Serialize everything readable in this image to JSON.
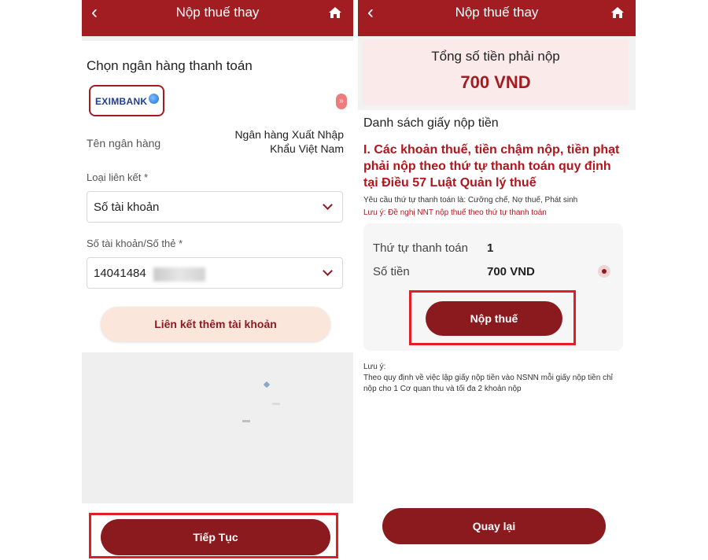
{
  "left": {
    "header": {
      "title": "Nộp thuế thay"
    },
    "section_title": "Chọn ngân hàng thanh toán",
    "bank": {
      "logo_text": "EXIMBANK",
      "name_label": "Tên ngân hàng",
      "name_value": "Ngân hàng Xuất Nhập Khẩu Việt Nam"
    },
    "scroll_indicator": "»",
    "link_type": {
      "label": "Loại liên kết *",
      "value": "Số tài khoản"
    },
    "account": {
      "label": "Số tài khoản/Số thẻ *",
      "value": "14041484"
    },
    "link_more_button": "Liên kết thêm tài khoản",
    "continue_button": "Tiếp Tục"
  },
  "right": {
    "header": {
      "title": "Nộp thuế thay"
    },
    "total_label": "Tổng số tiền phải nộp",
    "total_value": "700 VND",
    "list_title": "Danh sách giấy nộp tiền",
    "heading": "I. Các khoản thuế, tiền chậm nộp, tiền phạt phải nộp theo thứ tự thanh toán quy định tại Điều 57 Luật Quản lý thuế",
    "requirement": "Yêu cầu thứ tự thanh toán là: Cưỡng chế, Nợ thuế, Phát sinh",
    "reminder": "Lưu ý: Đề nghị NNT nộp thuế theo thứ tự thanh toán",
    "order_label": "Thứ tự thanh toán",
    "order_value": "1",
    "amount_label": "Số tiền",
    "amount_value": "700 VND",
    "pay_button": "Nộp thuế",
    "note_title": "Lưu ý:",
    "note_body": "Theo quy định về việc lập giấy nộp tiền vào NSNN mỗi giấy nộp tiền chỉ nộp cho 1 Cơ quan thu và tối đa 2 khoản nộp",
    "back_button": "Quay lại"
  },
  "colors": {
    "brand": "#a11d22",
    "button": "#8b1a1f",
    "highlight": "#e21d26",
    "light_pill": "#fbe6dc"
  },
  "icons": [
    "chevron-left-icon",
    "home-icon",
    "chevron-down-icon",
    "globe-icon",
    "radio-icon"
  ]
}
